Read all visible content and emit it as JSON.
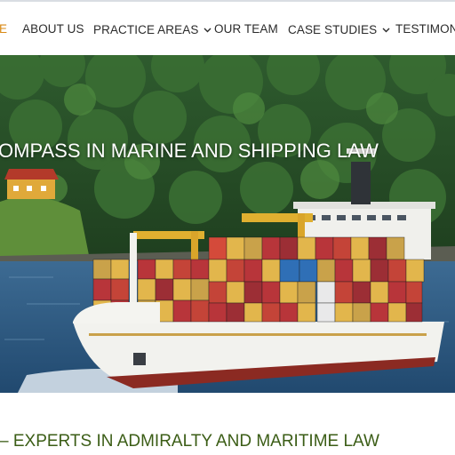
{
  "nav": {
    "items": [
      {
        "label": "E",
        "active": true,
        "has_dropdown": false
      },
      {
        "label": "ABOUT US",
        "active": false,
        "has_dropdown": false
      },
      {
        "label": "PRACTICE AREAS",
        "active": false,
        "has_dropdown": true
      },
      {
        "label": "OUR TEAM",
        "active": false,
        "has_dropdown": false
      },
      {
        "label": "CASE STUDIES",
        "active": false,
        "has_dropdown": true
      },
      {
        "label": "TESTIMONIA",
        "active": false,
        "has_dropdown": false
      }
    ],
    "chevron_icon": "chevron-down-icon"
  },
  "hero": {
    "title": "OMPASS IN MARINE AND SHIPPING LAW",
    "image": "container-ship-on-water-with-forest-and-red-cabin"
  },
  "section": {
    "heading": "– EXPERTS IN ADMIRALTY AND MARITIME LAW"
  },
  "colors": {
    "nav_active": "#d98a16",
    "nav_text": "#2b2b2b",
    "heading_green": "#3b5d16",
    "hero_title": "#ffffff"
  }
}
